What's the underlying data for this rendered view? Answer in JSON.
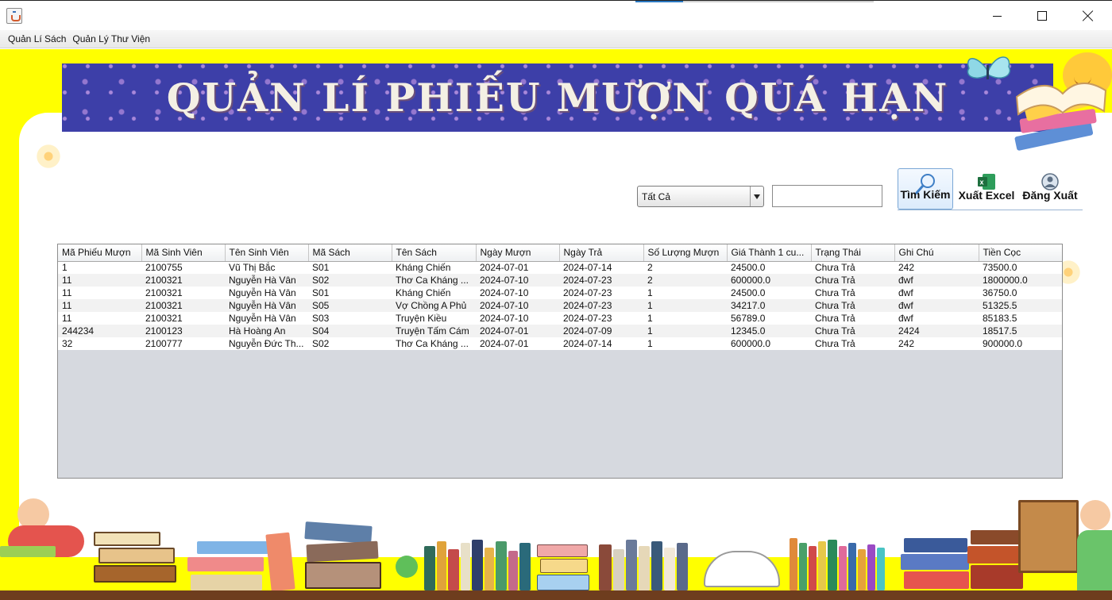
{
  "window": {
    "min_glyph": "",
    "max_glyph": "",
    "close_glyph": ""
  },
  "menu": {
    "items": [
      "Quản Lí Sách",
      "Quản Lý Thư Viện"
    ]
  },
  "banner": {
    "title": "QUẢN LÍ  PHIẾU MƯỢN QUÁ HẠN"
  },
  "toolbar": {
    "filter_selected": "Tất Cả",
    "search_value": "",
    "search_label": "Tìm Kiếm",
    "excel_label": "Xuất Excel",
    "logout_label": "Đăng Xuất"
  },
  "table": {
    "columns": [
      "Mã Phiếu Mượn",
      "Mã Sinh Viên",
      "Tên Sinh Viên",
      "Mã Sách",
      "Tên Sách",
      "Ngày Mượn",
      "Ngày Trả",
      "Số Lượng Mượn",
      "Giá Thành 1 cu...",
      "Trạng Thái",
      "Ghi Chú",
      "Tiền Cọc"
    ],
    "rows": [
      [
        "1",
        "2100755",
        "Vũ Thị Bắc",
        "S01",
        "Kháng Chiến",
        "2024-07-01",
        "2024-07-14",
        "2",
        "24500.0",
        "Chưa Trả",
        "242",
        "73500.0"
      ],
      [
        "11",
        "2100321",
        "Nguyễn Hà Vân",
        "S02",
        "Thơ Ca Kháng ...",
        "2024-07-10",
        "2024-07-23",
        "2",
        "600000.0",
        "Chưa Trả",
        "đwf",
        "1800000.0"
      ],
      [
        "11",
        "2100321",
        "Nguyễn Hà Vân",
        "S01",
        "Kháng Chiến",
        "2024-07-10",
        "2024-07-23",
        "1",
        "24500.0",
        "Chưa Trả",
        "đwf",
        "36750.0"
      ],
      [
        "11",
        "2100321",
        "Nguyễn Hà Vân",
        "S05",
        "Vợ Chồng A Phủ",
        "2024-07-10",
        "2024-07-23",
        "1",
        "34217.0",
        "Chưa Trả",
        "đwf",
        "51325.5"
      ],
      [
        "11",
        "2100321",
        "Nguyễn Hà Vân",
        "S03",
        "Truyện Kiều",
        "2024-07-10",
        "2024-07-23",
        "1",
        "56789.0",
        "Chưa Trả",
        "đwf",
        "85183.5"
      ],
      [
        "244234",
        "2100123",
        "Hà Hoàng An",
        "S04",
        "Truyện Tấm Cám",
        "2024-07-01",
        "2024-07-09",
        "1",
        "12345.0",
        "Chưa Trả",
        "2424",
        "18517.5"
      ],
      [
        "32",
        "2100777",
        "Nguyễn Đức Th...",
        "S02",
        "Thơ Ca Kháng ...",
        "2024-07-01",
        "2024-07-14",
        "1",
        "600000.0",
        "Chưa Trả",
        "242",
        "900000.0"
      ]
    ]
  },
  "colors": {
    "background": "#ffff00",
    "banner": "#3d3fa8",
    "shelf": "#6e3d1e"
  },
  "icons": {
    "search": "magnifier-icon",
    "excel": "excel-icon",
    "logout": "user-icon"
  }
}
